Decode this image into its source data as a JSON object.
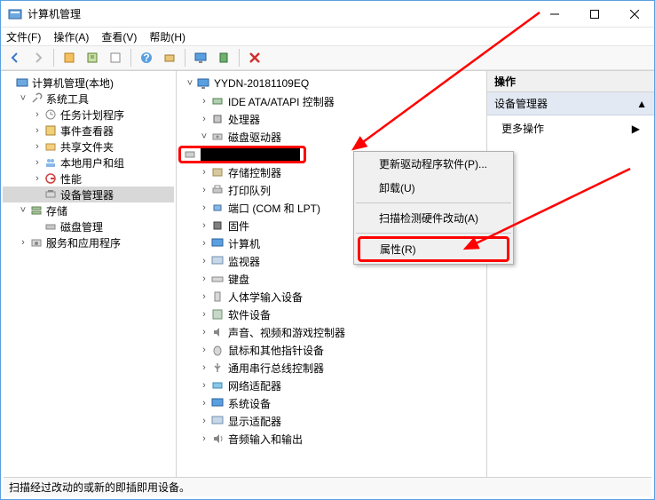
{
  "window": {
    "title": "计算机管理",
    "min": "—",
    "max": "☐",
    "close": "✕"
  },
  "menu": {
    "file": "文件(F)",
    "action": "操作(A)",
    "view": "查看(V)",
    "help": "帮助(H)"
  },
  "left_tree": {
    "root": "计算机管理(本地)",
    "system_tools": "系统工具",
    "task_scheduler": "任务计划程序",
    "event_viewer": "事件查看器",
    "shared_folders": "共享文件夹",
    "local_users": "本地用户和组",
    "performance": "性能",
    "device_manager": "设备管理器",
    "storage": "存储",
    "disk_management": "磁盘管理",
    "services": "服务和应用程序"
  },
  "devices": {
    "root": "YYDN-20181109EQ",
    "ide": "IDE ATA/ATAPI 控制器",
    "cpu": "处理器",
    "disk_drives": "磁盘驱动器",
    "storage_ctrl": "存储控制器",
    "print_queue": "打印队列",
    "ports": "端口 (COM 和 LPT)",
    "firmware": "固件",
    "computer": "计算机",
    "monitors": "监视器",
    "keyboards": "键盘",
    "hid": "人体学输入设备",
    "software_dev": "软件设备",
    "sound": "声音、视频和游戏控制器",
    "mice": "鼠标和其他指针设备",
    "usb_serial": "通用串行总线控制器",
    "network": "网络适配器",
    "system_dev": "系统设备",
    "display": "显示适配器",
    "audio_io": "音频输入和输出"
  },
  "context_menu": {
    "update_driver": "更新驱动程序软件(P)...",
    "uninstall": "卸载(U)",
    "scan_hw": "扫描检测硬件改动(A)",
    "properties": "属性(R)"
  },
  "right_panel": {
    "header": "操作",
    "section": "设备管理器",
    "more": "更多操作"
  },
  "statusbar": "扫描经过改动的或新的即插即用设备。"
}
